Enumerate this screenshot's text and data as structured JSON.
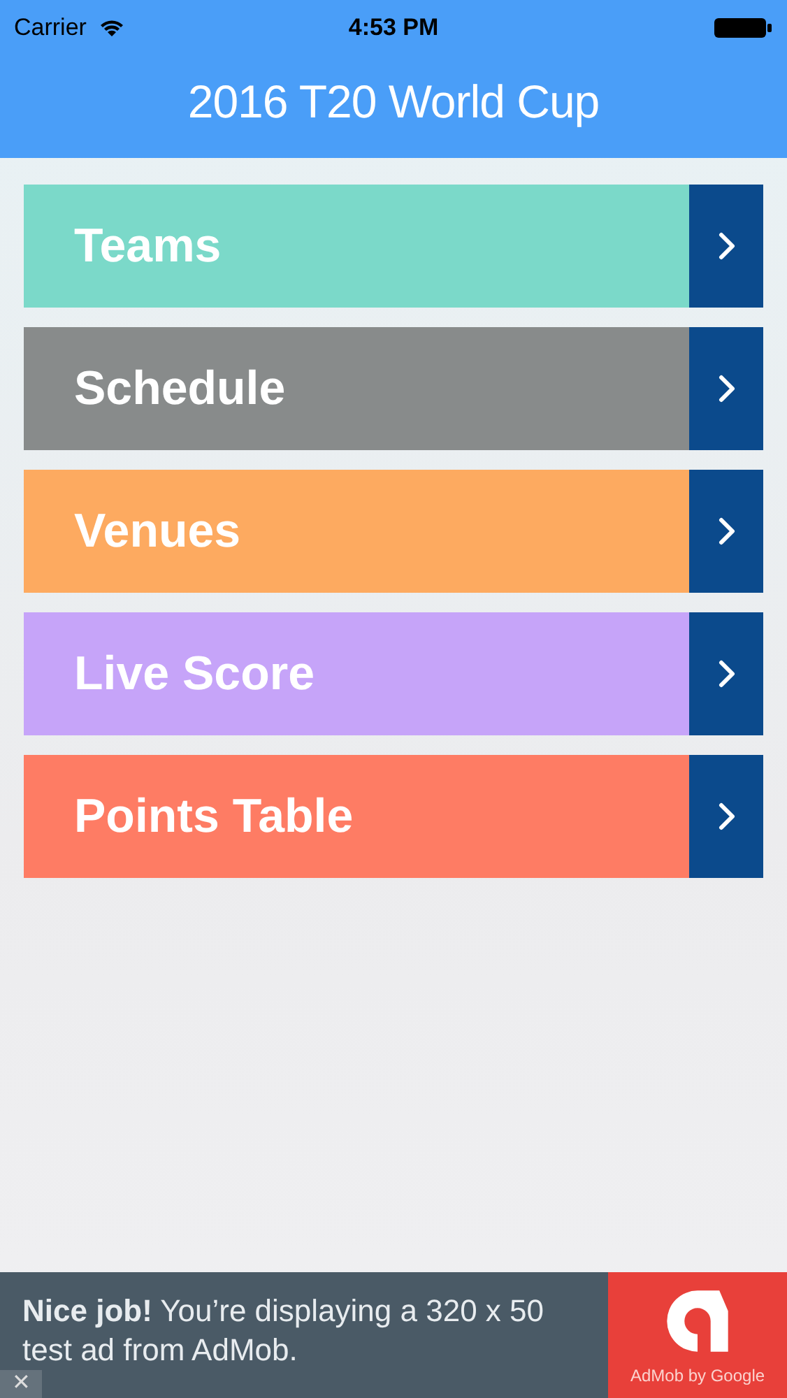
{
  "status_bar": {
    "carrier": "Carrier",
    "time": "4:53 PM"
  },
  "nav_bar": {
    "title": "2016 T20 World Cup"
  },
  "menu": [
    {
      "label": "Teams",
      "color": "#7bd9c9"
    },
    {
      "label": "Schedule",
      "color": "#888b8b"
    },
    {
      "label": "Venues",
      "color": "#fdaa60"
    },
    {
      "label": "Live Score",
      "color": "#c6a4f9"
    },
    {
      "label": "Points Table",
      "color": "#fe7c64"
    }
  ],
  "ad_banner": {
    "text": "**Nice job!** You’re displaying a 320 x 50 test ad from AdMob.",
    "close": "✕",
    "brand": "AdMob by Google"
  }
}
